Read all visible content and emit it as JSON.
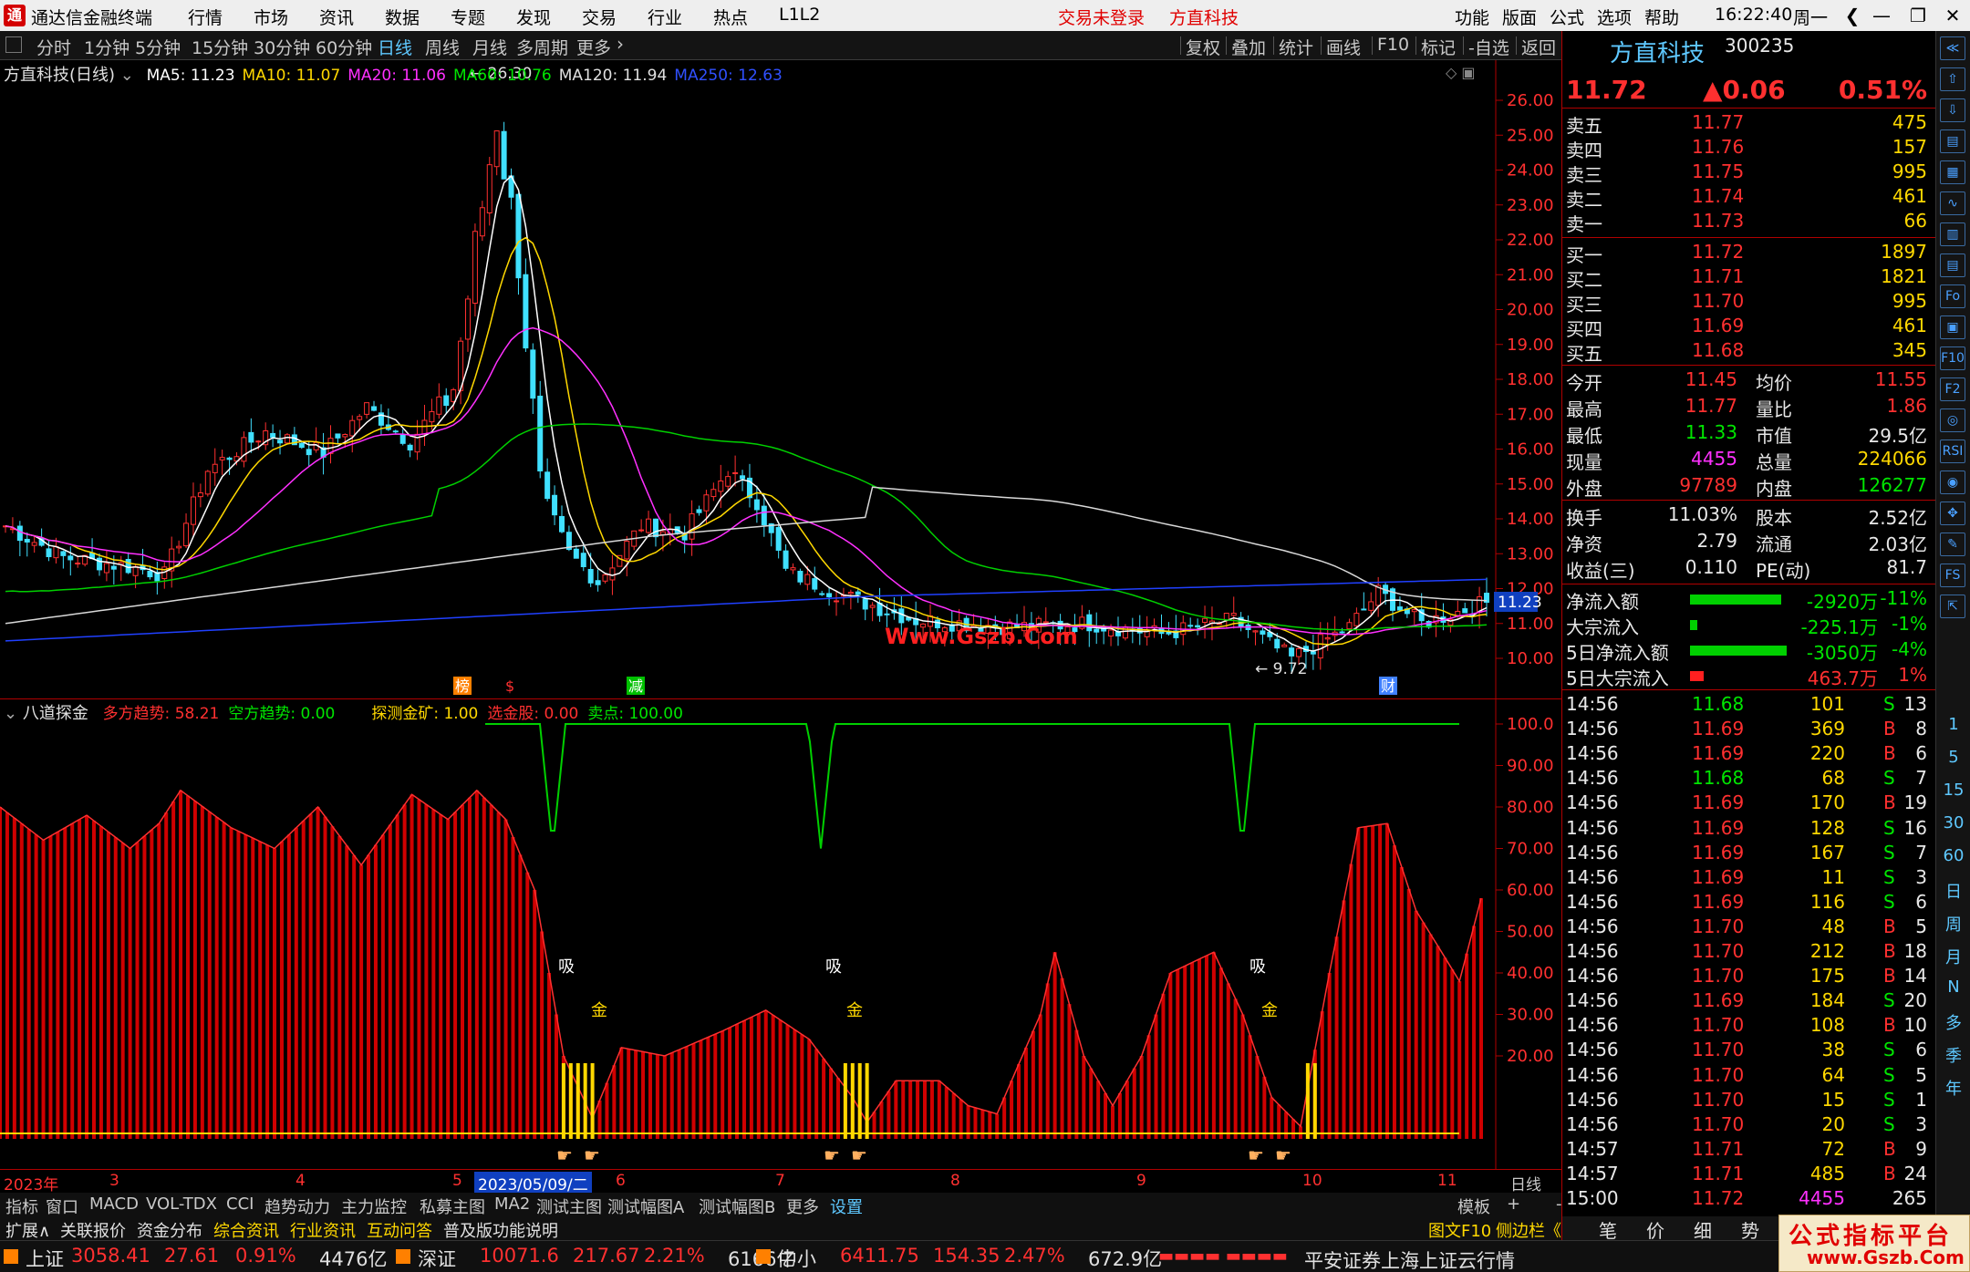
{
  "titlebar": {
    "title": "通达信金融终端",
    "menus": [
      "行情",
      "市场",
      "资讯",
      "数据",
      "专题",
      "发现",
      "交易",
      "行业",
      "热点",
      "L1L2"
    ],
    "login_alert": "交易未登录",
    "stock_alert": "方直科技",
    "right_menus": [
      "功能",
      "版面",
      "公式",
      "选项",
      "帮助"
    ],
    "clock": "16:22:40",
    "weekday": "周一"
  },
  "periods": [
    "分时",
    "1分钟",
    "5分钟",
    "15分钟",
    "30分钟",
    "60分钟",
    "日线",
    "周线",
    "月线",
    "多周期",
    "更多"
  ],
  "active_period": "日线",
  "right_tools": [
    "复权",
    "叠加",
    "统计",
    "画线",
    "F10",
    "标记",
    "-自选",
    "返回"
  ],
  "main": {
    "name": "方直科技(日线)",
    "ma": [
      {
        "label": "MA5: 11.23",
        "color": "#ffffff"
      },
      {
        "label": "MA10: 11.07",
        "color": "#ffd800"
      },
      {
        "label": "MA20: 11.06",
        "color": "#ff30ff"
      },
      {
        "label": "MA60: 10.76",
        "color": "#00e600"
      },
      {
        "label": "MA120: 11.94",
        "color": "#e0e0e0"
      },
      {
        "label": "MA250: 12.63",
        "color": "#3050ff"
      }
    ],
    "high_label": "26.30",
    "low_label": "9.72",
    "price_tag": "11.23",
    "watermark": "Www.Gszb.Com",
    "events": [
      "榜",
      "$",
      "减",
      "财"
    ],
    "yticks": [
      "26.00",
      "25.00",
      "24.00",
      "23.00",
      "22.00",
      "21.00",
      "20.00",
      "19.00",
      "18.00",
      "17.00",
      "16.00",
      "15.00",
      "14.00",
      "13.00",
      "12.00",
      "11.00",
      "10.00"
    ]
  },
  "indicator": {
    "name": "八道探金",
    "lines": [
      {
        "label": "多方趋势: 58.21",
        "color": "#ff3030"
      },
      {
        "label": "空方趋势: 0.00",
        "color": "#00e600"
      },
      {
        "label": "探测金矿: 1.00",
        "color": "#ffd800"
      },
      {
        "label": "选金股: 0.00",
        "color": "#ff3030"
      },
      {
        "label": "卖点: 100.00",
        "color": "#00e600"
      }
    ],
    "yticks": [
      "100.0",
      "90.00",
      "80.00",
      "70.00",
      "60.00",
      "50.00",
      "40.00",
      "30.00",
      "20.00"
    ],
    "markers": [
      "吸",
      "金"
    ]
  },
  "dates": [
    "2023年",
    "3",
    "4",
    "5",
    "2023/05/09/二",
    "6",
    "7",
    "8",
    "9",
    "10",
    "11"
  ],
  "date_axis_right": "日线",
  "tabs": [
    "指标",
    "窗口",
    "MACD",
    "VOL-TDX",
    "CCI",
    "趋势动力",
    "主力监控",
    "私募主图",
    "MA2",
    "测试主图",
    "测试幅图A",
    "测试幅图B",
    "更多",
    "设置"
  ],
  "tab_active": "设置",
  "tab_right": [
    "模板",
    "+",
    "-"
  ],
  "tabs2": [
    "扩展∧",
    "关联报价",
    "资金分布",
    "综合资讯",
    "行业资讯",
    "互动问答",
    "普及版功能说明"
  ],
  "tabs2_right": "图文F10",
  "sidebar_toggle": "侧边栏《",
  "quote": {
    "name": "方直科技",
    "code": "300235",
    "price": "11.72",
    "change": "▲0.06",
    "pct": "0.51%",
    "asks": [
      [
        "卖五",
        "11.77",
        "475"
      ],
      [
        "卖四",
        "11.76",
        "157"
      ],
      [
        "卖三",
        "11.75",
        "995"
      ],
      [
        "卖二",
        "11.74",
        "461"
      ],
      [
        "卖一",
        "11.73",
        "66"
      ]
    ],
    "bids": [
      [
        "买一",
        "11.72",
        "1897"
      ],
      [
        "买二",
        "11.71",
        "1821"
      ],
      [
        "买三",
        "11.70",
        "995"
      ],
      [
        "买四",
        "11.69",
        "461"
      ],
      [
        "买五",
        "11.68",
        "345"
      ]
    ],
    "stats": [
      [
        "今开",
        "11.45",
        "均价",
        "11.55"
      ],
      [
        "最高",
        "11.77",
        "量比",
        "1.86"
      ],
      [
        "最低",
        "11.33",
        "市值",
        "29.5亿"
      ],
      [
        "现量",
        "4455",
        "总量",
        "224066"
      ],
      [
        "外盘",
        "97789",
        "内盘",
        "126277"
      ]
    ],
    "stats2": [
      [
        "换手",
        "11.03%",
        "股本",
        "2.52亿"
      ],
      [
        "净资",
        "2.79",
        "流通",
        "2.03亿"
      ],
      [
        "收益(三)",
        "0.110",
        "PE(动)",
        "81.7"
      ]
    ],
    "flows": [
      [
        "净流入额",
        "-2920万",
        "-11%",
        0.8
      ],
      [
        "大宗流入",
        "-225.1万",
        "-1%",
        0.06
      ],
      [
        "5日净流入额",
        "-3050万",
        "-4%",
        0.85
      ],
      [
        "5日大宗流入",
        "463.7万",
        "1%",
        0.12
      ]
    ],
    "ticks": [
      [
        "14:56",
        "11.68",
        "101",
        "S",
        "13"
      ],
      [
        "14:56",
        "11.69",
        "369",
        "B",
        "8"
      ],
      [
        "14:56",
        "11.69",
        "220",
        "B",
        "6"
      ],
      [
        "14:56",
        "11.68",
        "68",
        "S",
        "7"
      ],
      [
        "14:56",
        "11.69",
        "170",
        "B",
        "19"
      ],
      [
        "14:56",
        "11.69",
        "128",
        "S",
        "16"
      ],
      [
        "14:56",
        "11.69",
        "167",
        "S",
        "7"
      ],
      [
        "14:56",
        "11.69",
        "11",
        "S",
        "3"
      ],
      [
        "14:56",
        "11.69",
        "116",
        "S",
        "6"
      ],
      [
        "14:56",
        "11.70",
        "48",
        "B",
        "5"
      ],
      [
        "14:56",
        "11.70",
        "212",
        "B",
        "18"
      ],
      [
        "14:56",
        "11.70",
        "175",
        "B",
        "14"
      ],
      [
        "14:56",
        "11.69",
        "184",
        "S",
        "20"
      ],
      [
        "14:56",
        "11.70",
        "108",
        "B",
        "10"
      ],
      [
        "14:56",
        "11.70",
        "38",
        "S",
        "6"
      ],
      [
        "14:56",
        "11.70",
        "64",
        "S",
        "5"
      ],
      [
        "14:56",
        "11.70",
        "15",
        "S",
        "1"
      ],
      [
        "14:56",
        "11.70",
        "20",
        "S",
        "3"
      ],
      [
        "14:57",
        "11.71",
        "72",
        "B",
        "9"
      ],
      [
        "14:57",
        "11.71",
        "485",
        "B",
        "24"
      ],
      [
        "15:00",
        "11.72",
        "4455",
        "",
        "265"
      ]
    ],
    "bottom_tabs": [
      "笔",
      "价",
      "细",
      "势"
    ]
  },
  "sidebar_text": [
    "1",
    "5",
    "15",
    "30",
    "60",
    "日",
    "周",
    "月",
    "N",
    "多",
    "季",
    "年"
  ],
  "status": {
    "items": [
      {
        "name": "上证",
        "value": "3058.41",
        "chg": "27.61",
        "pct": "0.91%",
        "amt": "4476亿"
      },
      {
        "name": "深证",
        "value": "10071.6",
        "chg": "217.67",
        "pct": "2.21%",
        "amt": "6166亿"
      },
      {
        "name": "中小",
        "value": "6411.75",
        "chg": "154.35",
        "pct": "2.47%",
        "amt": "672.9亿"
      }
    ],
    "broker": "平安证券上海上证云行情",
    "logo_title": "公式指标平台",
    "logo_url": "www.Gszb.Com"
  }
}
